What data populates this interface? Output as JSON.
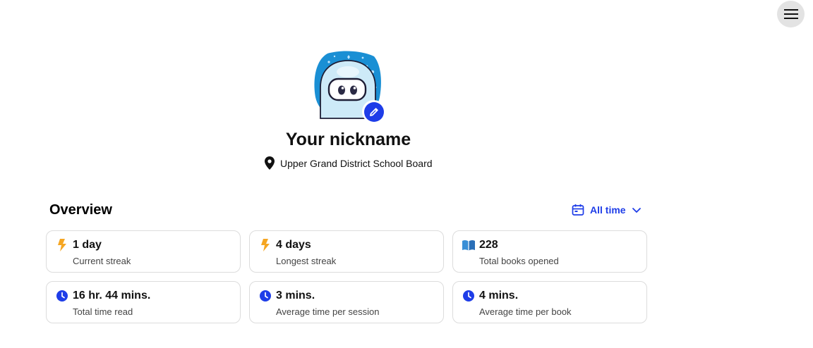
{
  "profile": {
    "nickname": "Your nickname",
    "location": "Upper Grand District School Board"
  },
  "overview": {
    "title": "Overview",
    "period_label": "All time",
    "stats": [
      {
        "icon": "lightning-icon",
        "value": "1 day",
        "label": "Current streak"
      },
      {
        "icon": "lightning-icon",
        "value": "4 days",
        "label": "Longest streak"
      },
      {
        "icon": "open-book-icon",
        "value": "228",
        "label": "Total books opened"
      },
      {
        "icon": "clock-icon",
        "value": "16 hr. 44 mins.",
        "label": "Total time read"
      },
      {
        "icon": "clock-icon",
        "value": "3 mins.",
        "label": "Average time per session"
      },
      {
        "icon": "clock-icon",
        "value": "4 mins.",
        "label": "Average time per book"
      }
    ]
  },
  "colors": {
    "accent": "#1e3de8",
    "streak": "#f5a623",
    "book": "#3a8fd6",
    "card_border": "#dcdcdc",
    "menu_bg": "#e3e3e3"
  }
}
